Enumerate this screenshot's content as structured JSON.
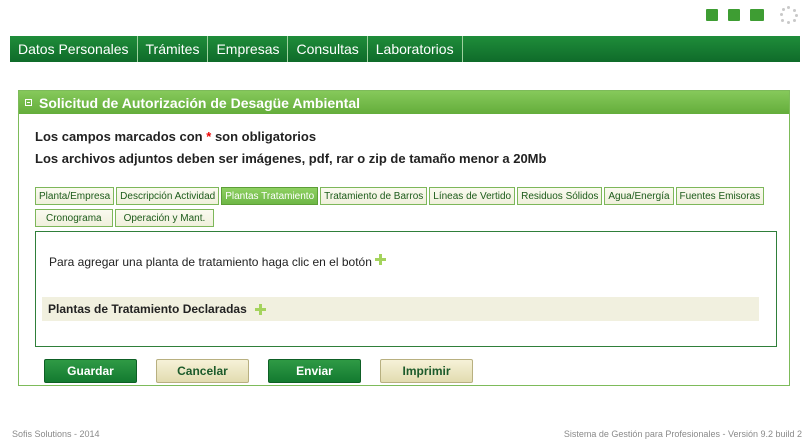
{
  "nav": {
    "items": [
      "Datos Personales",
      "Trámites",
      "Empresas",
      "Consultas",
      "Laboratorios"
    ]
  },
  "panel": {
    "title": "Solicitud de Autorización de Desagüe Ambiental",
    "note_required_prefix": "Los campos marcados con",
    "note_required_mark": "*",
    "note_required_suffix": "son obligatorios",
    "note_attachments": "Los archivos adjuntos deben ser imágenes, pdf, rar o zip de tamaño menor a 20Mb"
  },
  "tabs": {
    "row1": [
      "Planta/Empresa",
      "Descripción Actividad",
      "Plantas Tratamiento",
      "Tratamiento de Barros",
      "Líneas de Vertido",
      "Residuos Sólidos",
      "Agua/Energía",
      "Fuentes Emisoras"
    ],
    "row2": [
      "Cronograma",
      "Operación y Mant."
    ],
    "active": "Plantas Tratamiento"
  },
  "content": {
    "hint": "Para agregar una planta de tratamiento haga clic en el botón",
    "declared_label": "Plantas de Tratamiento Declaradas"
  },
  "buttons": {
    "guardar": "Guardar",
    "cancelar": "Cancelar",
    "enviar": "Enviar",
    "imprimir": "Imprimir"
  },
  "footer": {
    "left": "Sofis Solutions - 2014",
    "right": "Sistema de Gestión para Profesionales - Versión 9.2 build 2"
  },
  "colors": {
    "nav_green": "#137a30",
    "panel_green": "#6eb746",
    "required_red": "#e00000",
    "plus_green": "#a4d35c"
  },
  "icons": [
    "top-icon-1",
    "top-icon-2",
    "top-icon-3",
    "loading-spinner-icon",
    "plus-icon"
  ]
}
